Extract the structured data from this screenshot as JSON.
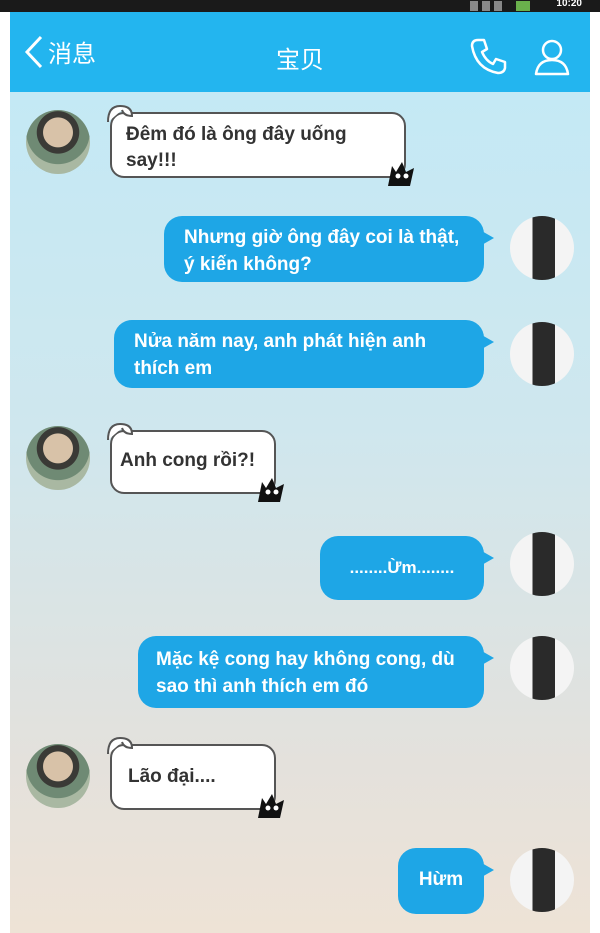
{
  "status_bar": {
    "time": "10:20"
  },
  "header": {
    "back_label": "消息",
    "title": "宝贝"
  },
  "messages": [
    {
      "side": "left",
      "text": "Đêm đó là ông đây uống say!!!"
    },
    {
      "side": "right",
      "text": "Nhưng giờ ông đây coi là thật, ý kiến không?"
    },
    {
      "side": "right",
      "text": "Nửa năm nay, anh phát hiện anh thích em"
    },
    {
      "side": "left",
      "text": "Anh cong rồi?!"
    },
    {
      "side": "right",
      "text": "........Ừm........"
    },
    {
      "side": "right",
      "text": "Mặc kệ cong hay không cong, dù sao thì anh thích em đó"
    },
    {
      "side": "left",
      "text": "Lão đại...."
    },
    {
      "side": "right",
      "text": "Hừm"
    }
  ],
  "colors": {
    "header": "#23b5ef",
    "outgoing_bubble": "#1ea6e6"
  }
}
